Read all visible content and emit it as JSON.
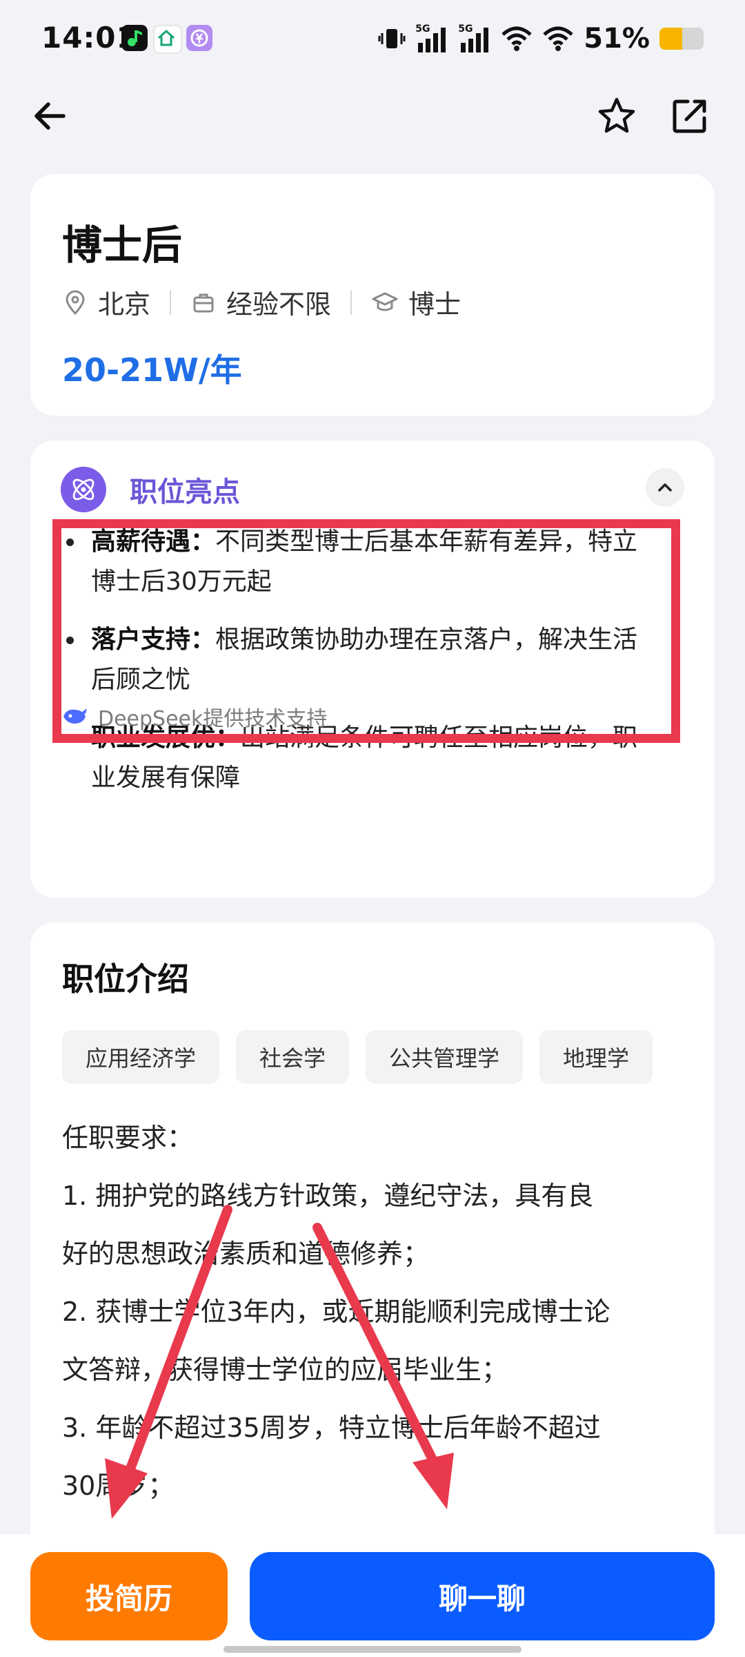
{
  "status_bar": {
    "time": "14:01",
    "network_1": "5G",
    "network_2": "5G",
    "battery_text": "51%",
    "battery_level": 0.51
  },
  "nav": {
    "back_icon": "arrow-left-icon",
    "favorite_icon": "star-outline-icon",
    "share_icon": "share-icon"
  },
  "job": {
    "title": "博士后",
    "location": "北京",
    "experience": "经验不限",
    "degree": "博士",
    "salary": "20-21W/年"
  },
  "highlights": {
    "title": "职位亮点",
    "items": [
      {
        "label": "高薪待遇：",
        "text": "不同类型博士后基本年薪有差异，特立",
        "text2": "博士后30万元起"
      },
      {
        "label": "落户支持：",
        "text": "根据政策协助办理在京落户，解决生活",
        "text2": "后顾之忧"
      },
      {
        "label": "职业发展优：",
        "text": "出站满足条件可聘任至相应岗位，职",
        "text2": "业发展有保障"
      }
    ],
    "powered_by": "DeepSeek提供技术支持"
  },
  "intro": {
    "title": "职位介绍",
    "tags": [
      "应用经济学",
      "社会学",
      "公共管理学",
      "地理学"
    ],
    "requirements": [
      "任职要求：",
      "1. 拥护党的路线方针政策，遵纪守法，具有良",
      "好的思想政治素质和道德修养；",
      "2. 获博士学位3年内，或近期能顺利完成博士论",
      "文答辩，获得博士学位的应届毕业生；",
      "3. 年龄不超过35周岁，特立博士后年龄不超过",
      "30周岁；"
    ]
  },
  "actions": {
    "apply": "投简历",
    "chat": "聊一聊"
  },
  "colors": {
    "accent_blue": "#1f6ee6",
    "apply_orange": "#ff7a00",
    "chat_blue": "#0a5cff",
    "highlight_purple": "#6d56d8",
    "annotation_red": "#e8394d"
  }
}
